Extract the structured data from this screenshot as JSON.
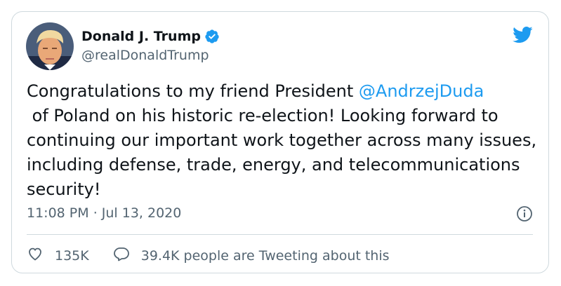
{
  "tweet": {
    "author_name": "Donald J. Trump",
    "author_handle": "@realDonaldTrump",
    "text_before": "Congratulations to my friend President ",
    "mention": "@AndrzejDuda",
    "text_after": " of Poland on his historic re-election! Looking forward to continuing our important work together across many issues, including defense, trade, energy, and telecommunications security!",
    "time": "11:08 PM",
    "separator": " · ",
    "date": "Jul 13, 2020",
    "like_count": "135K",
    "tweeting_text": "39.4K people are Tweeting about this"
  },
  "icons": {
    "verified": "verified-badge-icon",
    "logo": "twitter-bird-icon",
    "info": "info-icon",
    "like": "heart-icon",
    "reply": "speech-bubble-icon"
  },
  "colors": {
    "accent": "#1d9bf0",
    "text": "#0f1419",
    "secondary": "#536471",
    "border": "#cfd9de"
  }
}
